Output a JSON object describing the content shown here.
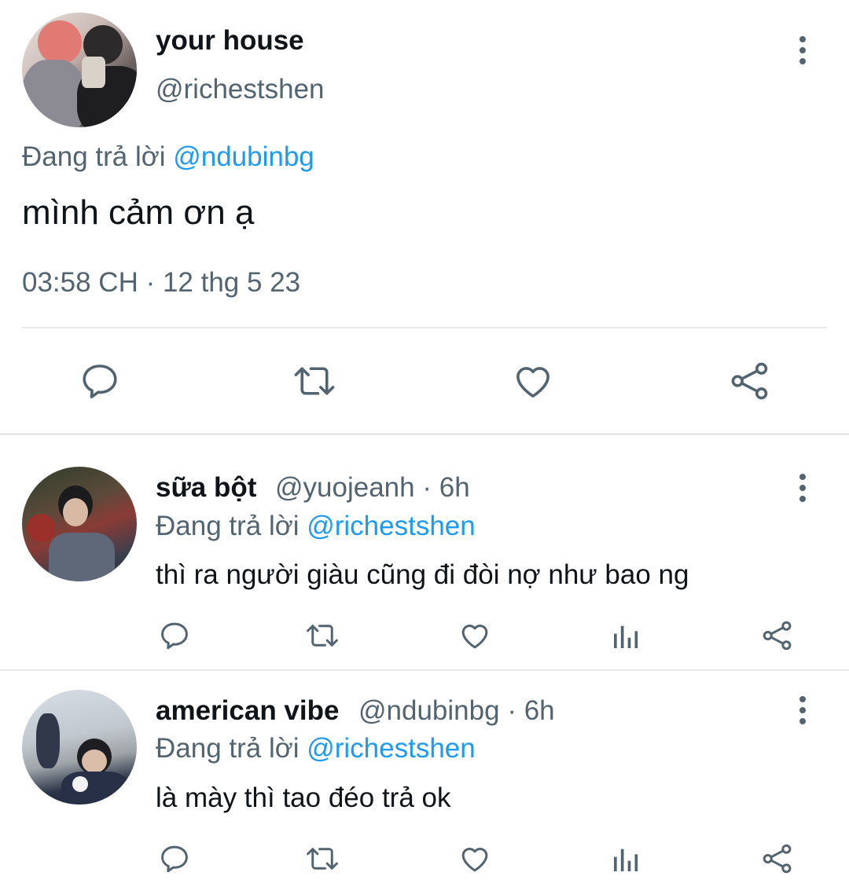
{
  "main_tweet": {
    "display_name": "your house",
    "handle": "@richestshen",
    "replying_prefix": "Đang trả lời",
    "replying_to": "@ndubinbg",
    "text": "mình cảm ơn ạ",
    "timestamp": "03:58 CH · 12 thg 5 23",
    "actions": [
      "reply-icon",
      "retweet-icon",
      "like-icon",
      "share-icon"
    ]
  },
  "replies": [
    {
      "display_name": "sữa bột",
      "handle": "@yuojeanh",
      "time": "· 6h",
      "replying_prefix": "Đang trả lời",
      "replying_to": "@richestshen",
      "text": "thì ra người giàu cũng đi đòi nợ như bao ng",
      "actions": [
        "reply-icon",
        "retweet-icon",
        "like-icon",
        "analytics-icon",
        "share-icon"
      ]
    },
    {
      "display_name": "american vibe",
      "handle": "@ndubinbg",
      "time": "· 6h",
      "replying_prefix": "Đang trả lời",
      "replying_to": "@richestshen",
      "text": "là mày thì tao đéo trả ok",
      "actions": [
        "reply-icon",
        "retweet-icon",
        "like-icon",
        "analytics-icon",
        "share-icon"
      ]
    }
  ],
  "colors": {
    "text_primary": "#0f1419",
    "text_secondary": "#536471",
    "link": "#1d9bf0",
    "divider": "#e7e9ea"
  }
}
